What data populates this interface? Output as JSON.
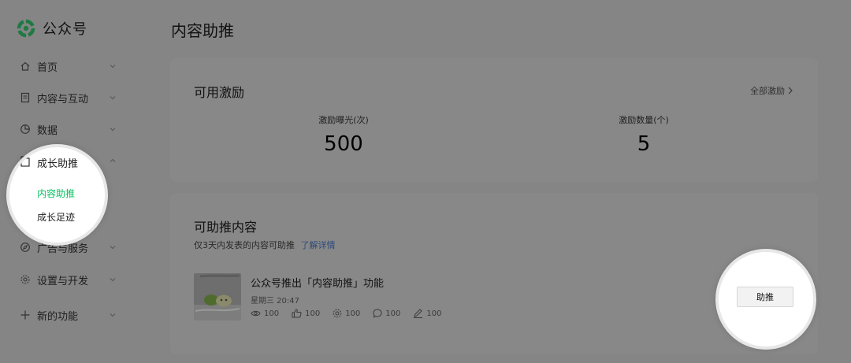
{
  "brand": {
    "name": "公众号",
    "logo_icon": "wechat-oa-logo-icon"
  },
  "sidebar": {
    "items": [
      {
        "label": "首页",
        "icon": "home-icon"
      },
      {
        "label": "内容与互动",
        "icon": "document-icon"
      },
      {
        "label": "数据",
        "icon": "pie-chart-icon"
      },
      {
        "label": "成长助推",
        "icon": "growth-icon",
        "expanded": true,
        "children": [
          {
            "label": "内容助推",
            "active": true
          },
          {
            "label": "成长足迹"
          }
        ]
      },
      {
        "label": "广告与服务",
        "icon": "compass-icon"
      },
      {
        "label": "设置与开发",
        "icon": "gear-icon"
      },
      {
        "label": "新的功能",
        "icon": "plus-icon"
      }
    ]
  },
  "page": {
    "title": "内容助推"
  },
  "incentives": {
    "title": "可用激励",
    "all_link": "全部激励",
    "stats": [
      {
        "label": "激励曝光(次)",
        "value": "500"
      },
      {
        "label": "激励数量(个)",
        "value": "5"
      }
    ]
  },
  "boostable": {
    "title": "可助推内容",
    "hint": "仅3天内发表的内容可助推",
    "hint_link": "了解详情",
    "article": {
      "title": "公众号推出「内容助推」功能",
      "time": "星期三 20:47",
      "metrics": [
        {
          "icon": "eye-icon",
          "value": "100"
        },
        {
          "icon": "thumbs-up-icon",
          "value": "100"
        },
        {
          "icon": "share-flower-icon",
          "value": "100"
        },
        {
          "icon": "comment-icon",
          "value": "100"
        },
        {
          "icon": "pen-icon",
          "value": "100"
        }
      ],
      "action_label": "助推"
    }
  },
  "colors": {
    "accent": "#07c160",
    "link": "#2c4a7a",
    "dim_overlay": "#858585",
    "card": "#888888"
  }
}
